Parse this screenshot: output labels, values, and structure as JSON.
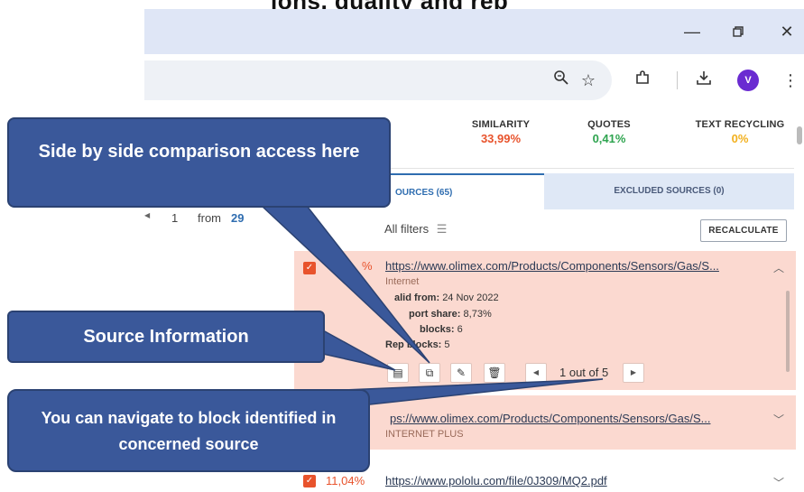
{
  "header_fragment": "ions, quality and rep",
  "window_controls": {
    "minimize": "—",
    "restore": "▢",
    "close": "✕"
  },
  "toolbar": {
    "zoom_icon": "zoom-icon",
    "bookmark_icon": "star-icon",
    "extensions_icon": "puzzle-icon",
    "download_icon": "download-icon",
    "avatar_letter": "V",
    "menu_icon": "kebab-menu-icon"
  },
  "stats": {
    "partial_label": "Y",
    "similarity": {
      "label": "SIMILARITY",
      "value": "33,99%",
      "color": "#e8532c"
    },
    "quotes": {
      "label": "QUOTES",
      "value": "0,41%",
      "color": "#2ea44f"
    },
    "text_recycling": {
      "label": "TEXT RECYCLING",
      "value": "0%",
      "color": "#f2b01e"
    }
  },
  "tabs": {
    "sources": "OURCES (65)",
    "excluded": "EXCLUDED SOURCES (0)"
  },
  "pager": {
    "current": "1",
    "from_label": "from",
    "total": "29"
  },
  "filters": {
    "label": "All filters",
    "recalculate": "RECALCULATE"
  },
  "sources": [
    {
      "percent": "%",
      "url": "https://www.olimex.com/Products/Components/Sensors/Gas/S...",
      "type": "Internet",
      "valid_from_label": "alid from:",
      "valid_from": "24 Nov 2022",
      "report_share_label": "port share:",
      "report_share": "8,73%",
      "total_blocks_label": "blocks:",
      "total_blocks": "6",
      "report_blocks_label": "Rep  blocks:",
      "report_blocks": "5",
      "block_nav": "1 out of 5"
    },
    {
      "url_partial": "ps://www.olimex.com/Products/Components/Sensors/Gas/S...",
      "type": "INTERNET PLUS"
    },
    {
      "percent": "11,04%",
      "url": "https://www.pololu.com/file/0J309/MQ2.pdf"
    }
  ],
  "callouts": {
    "side_by_side": "Side by side comparison access here",
    "source_info": "Source Information",
    "navigate_blocks": "You can navigate to block identified in concerned source"
  },
  "colors": {
    "callout_fill": "#3a589a",
    "card_background": "#fbd9d0",
    "accent_blue": "#2f6db0"
  }
}
